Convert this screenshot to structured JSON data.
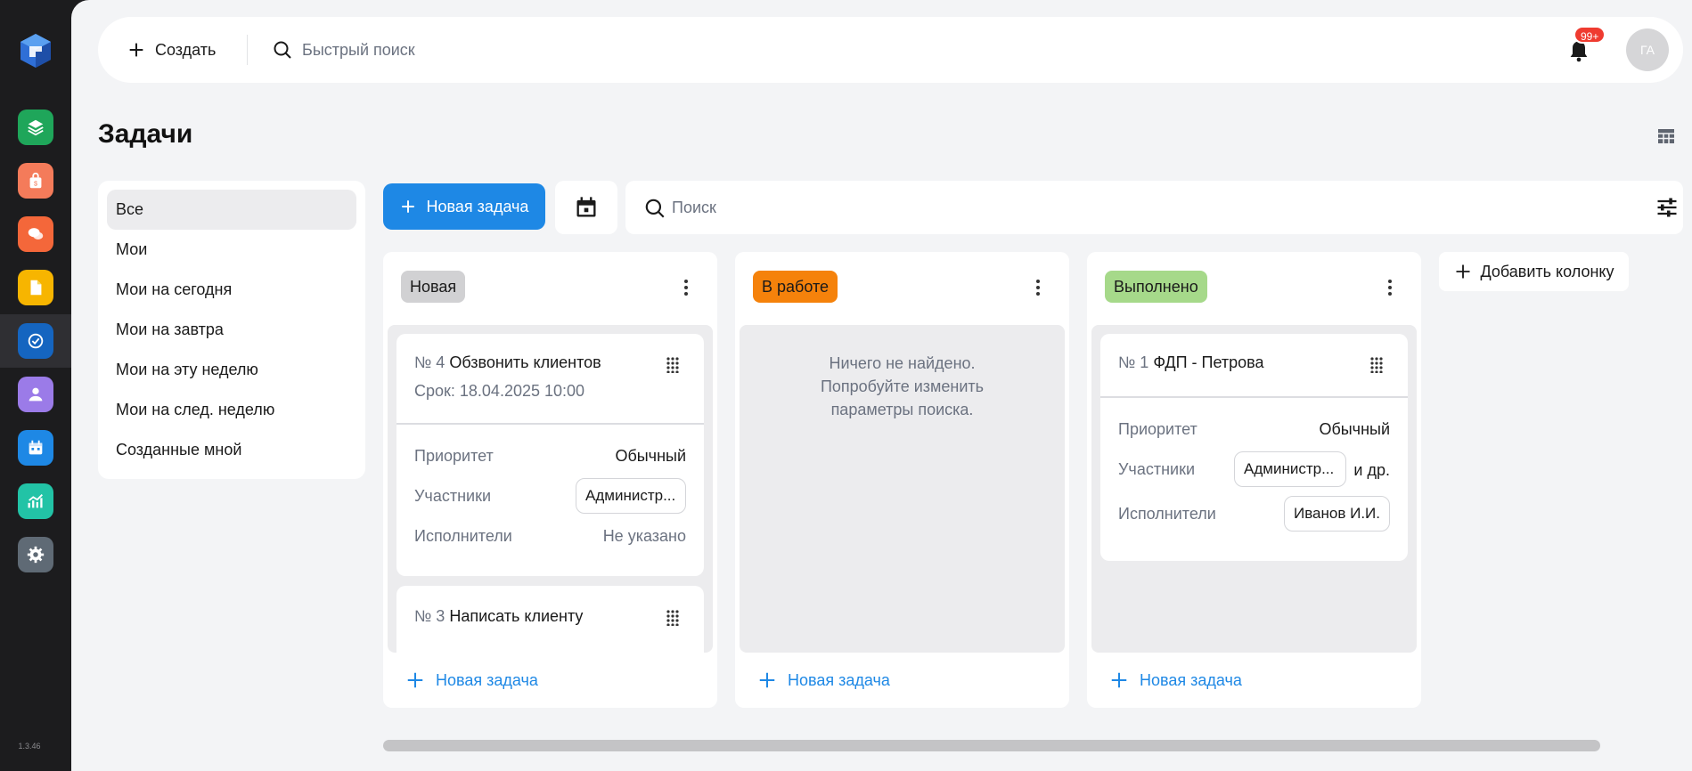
{
  "app": {
    "version": "1.3.46",
    "colors": {
      "accent": "#1e88e5",
      "sidebar_bg": "#1c1c1e",
      "notification_badge": "#ef3b30",
      "status_new": "#d1d1d3",
      "status_in_progress": "#f5820b",
      "status_done": "#a6d98a"
    }
  },
  "sidebar": {
    "logo": "app-logo",
    "items": [
      {
        "icon": "layers-icon",
        "color": "#1fa65a"
      },
      {
        "icon": "shopping-bag-icon",
        "color": "#f47b5a"
      },
      {
        "icon": "chat-icon",
        "color": "#f4673a"
      },
      {
        "icon": "document-icon",
        "color": "#f7b500"
      },
      {
        "icon": "check-circle-icon",
        "color": "#1565c0",
        "active": true
      },
      {
        "icon": "user-icon",
        "color": "#9b7be8"
      },
      {
        "icon": "calendar-icon",
        "color": "#1e88e5"
      },
      {
        "icon": "chart-icon",
        "color": "#22c3a6"
      },
      {
        "icon": "gear-icon",
        "color": "#5f6a75"
      }
    ]
  },
  "topbar": {
    "create_label": "Создать",
    "quick_search_placeholder": "Быстрый поиск",
    "notifications_badge": "99+",
    "avatar_initials": "ГА"
  },
  "page": {
    "title": "Задачи"
  },
  "filters": [
    "Все",
    "Мои",
    "Мои на сегодня",
    "Мои на завтра",
    "Мои на эту неделю",
    "Мои на след. неделю",
    "Созданные мной"
  ],
  "toolbar": {
    "new_task_label": "Новая задача",
    "search_placeholder": "Поиск"
  },
  "labels": {
    "priority": "Приоритет",
    "participants": "Участники",
    "executors": "Исполнители",
    "new_task": "Новая задача",
    "add_column": "Добавить колонку"
  },
  "columns": [
    {
      "title": "Новая",
      "cards": [
        {
          "number": "№ 4",
          "title": "Обзвонить клиентов",
          "deadline": "Срок: 18.04.2025 10:00",
          "priority": "Обычный",
          "participant": "Администр...",
          "executors": "Не указано"
        },
        {
          "number": "№ 3",
          "title": "Написать клиенту"
        }
      ]
    },
    {
      "title": "В работе",
      "empty_message": "Ничего не найдено. Попробуйте изменить параметры поиска."
    },
    {
      "title": "Выполнено",
      "cards": [
        {
          "number": "№ 1",
          "title": "ФДП - Петрова",
          "priority": "Обычный",
          "participant": "Администр...",
          "participants_more": "и др.",
          "executor": "Иванов И.И."
        }
      ]
    }
  ]
}
